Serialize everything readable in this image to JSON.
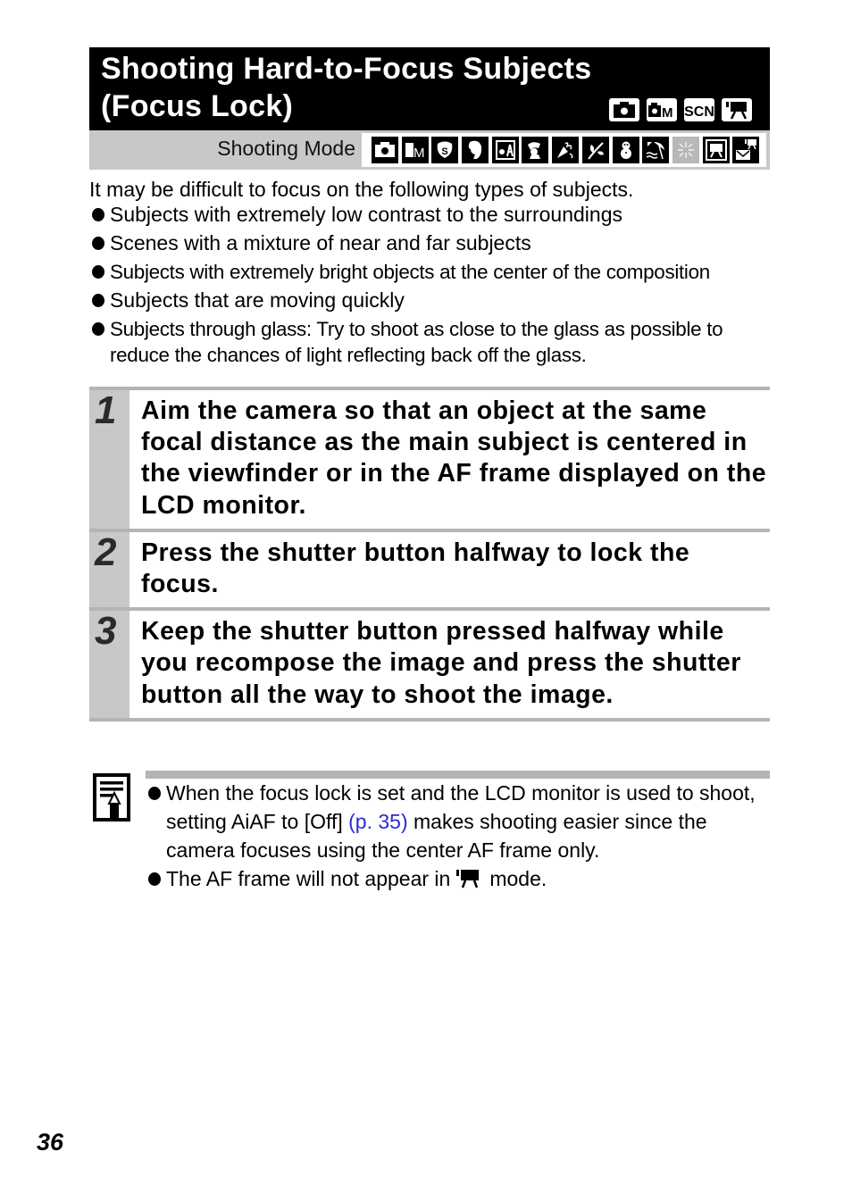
{
  "header": {
    "title_line1": "Shooting Hard-to-Focus Subjects",
    "title_line2": "(Focus Lock)",
    "mode_icons": [
      "auto-camera-icon",
      "camera-manual-icon",
      "scn-icon",
      "movie-icon"
    ],
    "scn_label": "SCN",
    "m_label": "M"
  },
  "shooting_mode": {
    "label": "Shooting Mode",
    "icons": [
      {
        "name": "auto-mode-icon",
        "enabled": true
      },
      {
        "name": "manual-mode-icon",
        "enabled": true
      },
      {
        "name": "digital-macro-icon",
        "enabled": true
      },
      {
        "name": "portrait-icon",
        "enabled": true
      },
      {
        "name": "kids-pets-icon",
        "enabled": true
      },
      {
        "name": "indoor-icon",
        "enabled": true
      },
      {
        "name": "party-icon",
        "enabled": true
      },
      {
        "name": "foliage-icon",
        "enabled": true
      },
      {
        "name": "snow-icon",
        "enabled": true
      },
      {
        "name": "beach-icon",
        "enabled": true
      },
      {
        "name": "fireworks-icon",
        "enabled": false
      },
      {
        "name": "movie-standard-icon",
        "enabled": true
      },
      {
        "name": "movie-email-icon",
        "enabled": true
      }
    ]
  },
  "intro": "It may be difficult to focus on the following types of subjects.",
  "subjects": [
    "Subjects with extremely low contrast to the surroundings",
    "Scenes with a mixture of near and far subjects",
    "Subjects with extremely bright objects at the center of the composition",
    "Subjects that are moving quickly",
    "Subjects through glass: Try to shoot as close to the glass as possible to reduce the chances of light reflecting back off the glass."
  ],
  "steps": [
    {
      "number": "1",
      "text": "Aim the camera so that an object at the same focal distance as the main subject is centered in the viewfinder or in the AF frame displayed on the LCD monitor."
    },
    {
      "number": "2",
      "text": "Press the shutter button halfway to lock the focus."
    },
    {
      "number": "3",
      "text": "Keep the shutter button pressed halfway while you recompose the image and press the shutter button all the way to shoot the image."
    }
  ],
  "notes": {
    "note1_before": "When the focus lock is set and the LCD monitor is used to shoot, setting AiAF to [Off] ",
    "note1_link": "(p. 35)",
    "note1_after": " makes shooting easier since the camera focuses using the center AF frame only.",
    "note2_before": "The AF frame will not appear in",
    "note2_after": "mode."
  },
  "colors": {
    "link": "#2b2bd6",
    "title_bg": "#000000",
    "band_grey": "#c8c8c8",
    "rule_grey": "#b4b4b4"
  },
  "page_number": "36"
}
